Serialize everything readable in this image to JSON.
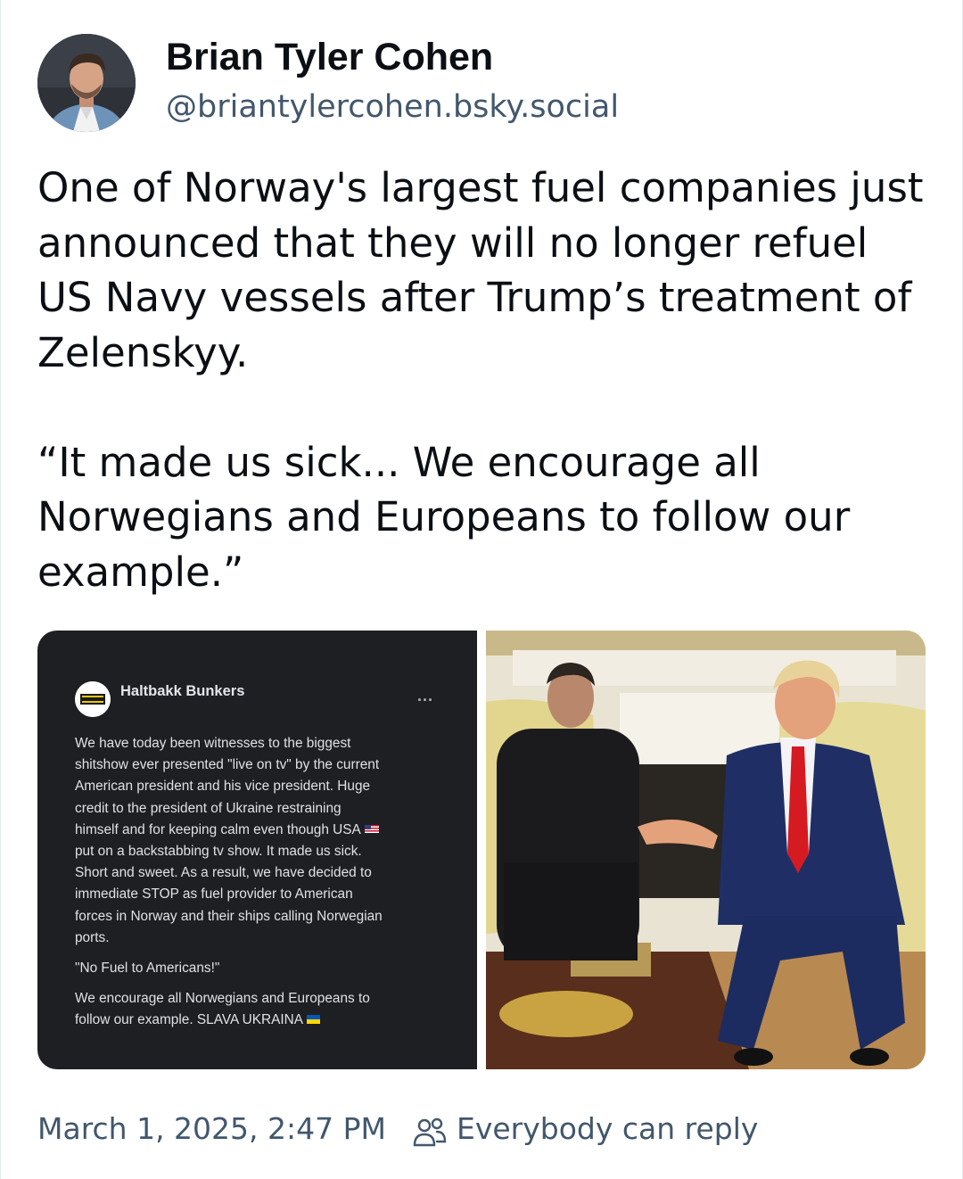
{
  "author": {
    "display_name": "Brian Tyler Cohen",
    "handle": "@briantylercohen.bsky.social"
  },
  "post": {
    "paragraphs": [
      "One of Norway's largest fuel companies just announced that they will no longer refuel US Navy vessels after Trump’s treatment of Zelenskyy.",
      "“It made us sick... We encourage all Norwegians and Europeans to follow our example.”"
    ]
  },
  "embed_screenshot": {
    "page_name": "Haltbakk Bunkers",
    "more": "...",
    "lines": [
      "We have today been witnesses to the biggest",
      "shitshow ever presented \"live on tv\" by the current",
      "American president and his vice president. Huge",
      "credit to the president of Ukraine restraining",
      "himself and for keeping calm even though USA",
      "put on a backstabbing tv show. It made us sick.",
      "Short and sweet. As a result, we have decided to",
      "immediate STOP as fuel provider to American",
      "forces in Norway and their ships calling Norwegian",
      "ports."
    ],
    "quote": "\"No Fuel to Americans!\"",
    "closing_lines": [
      "We encourage all Norwegians and Europeans to",
      "follow our example. SLAVA UKRAINA"
    ]
  },
  "footer": {
    "timestamp": "March 1, 2025, 2:47 PM",
    "reply_setting": "Everybody can reply",
    "reply_icon": "people-icon"
  },
  "colors": {
    "text": "#0b0f14",
    "muted": "#42576c",
    "embed_bg": "#1d1f23"
  }
}
